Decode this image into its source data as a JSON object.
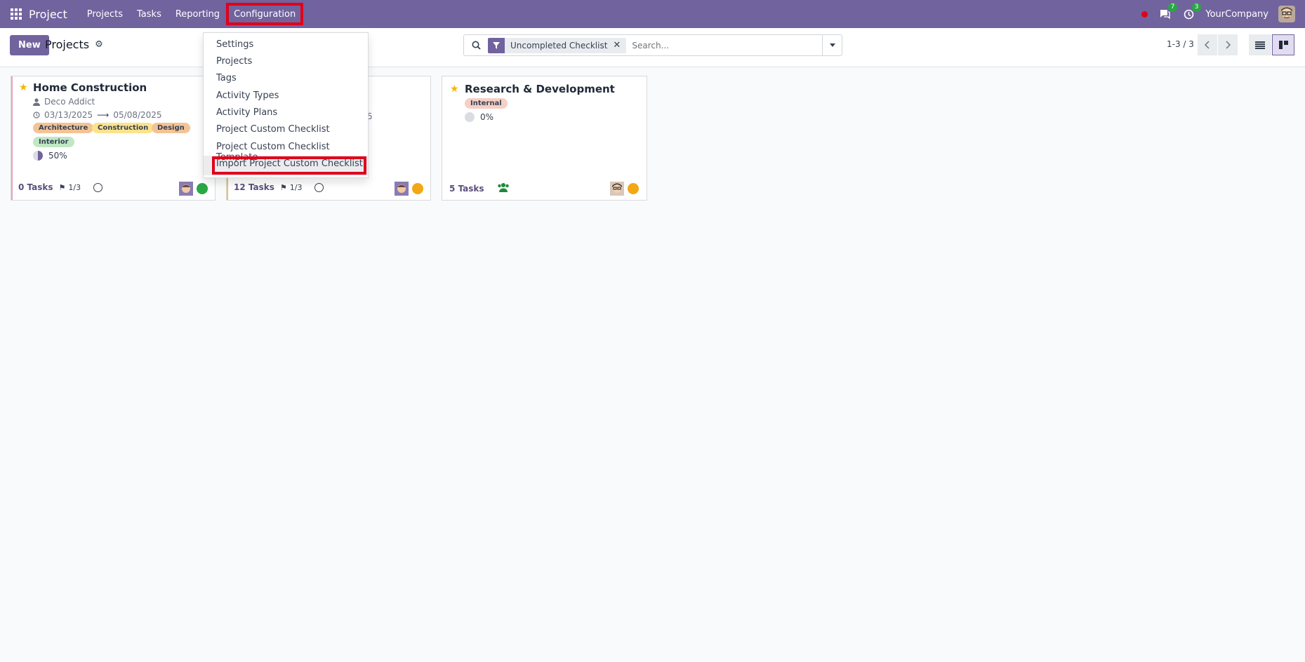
{
  "navbar": {
    "app_name": "Project",
    "menu": [
      "Projects",
      "Tasks",
      "Reporting",
      "Configuration"
    ],
    "chat_count": "7",
    "activity_count": "3",
    "company": "YourCompany"
  },
  "control": {
    "new_label": "New",
    "breadcrumb": "Projects",
    "facet": "Uncompleted Checklist",
    "search_placeholder": "Search...",
    "pager": "1-3 / 3"
  },
  "dropdown": {
    "items": [
      "Settings",
      "Projects",
      "Tags",
      "Activity Types",
      "Activity Plans",
      "Project Custom Checklist",
      "Project Custom Checklist Template",
      "Import Project Custom Checklist"
    ]
  },
  "cards": [
    {
      "title": "Home Construction",
      "customer": "Deco Addict",
      "date_start": "03/13/2025",
      "date_end": "05/08/2025",
      "tags": [
        "Architecture",
        "Construction",
        "Design",
        "Interior"
      ],
      "progress": "50%",
      "tasks": "0 Tasks",
      "milestones": "1/3",
      "status_color": "#28a745"
    },
    {
      "title": "",
      "date_fragment": "5",
      "tasks": "12 Tasks",
      "milestones": "1/3",
      "status_color": "#f3a712"
    },
    {
      "title": "Research & Development",
      "tags": [
        "Internal"
      ],
      "progress": "0%",
      "tasks": "5 Tasks",
      "status_color": "#f3a712"
    }
  ],
  "colors": {
    "brand": "#71639e",
    "highlight": "#e0001a",
    "star": "#f3b700"
  }
}
